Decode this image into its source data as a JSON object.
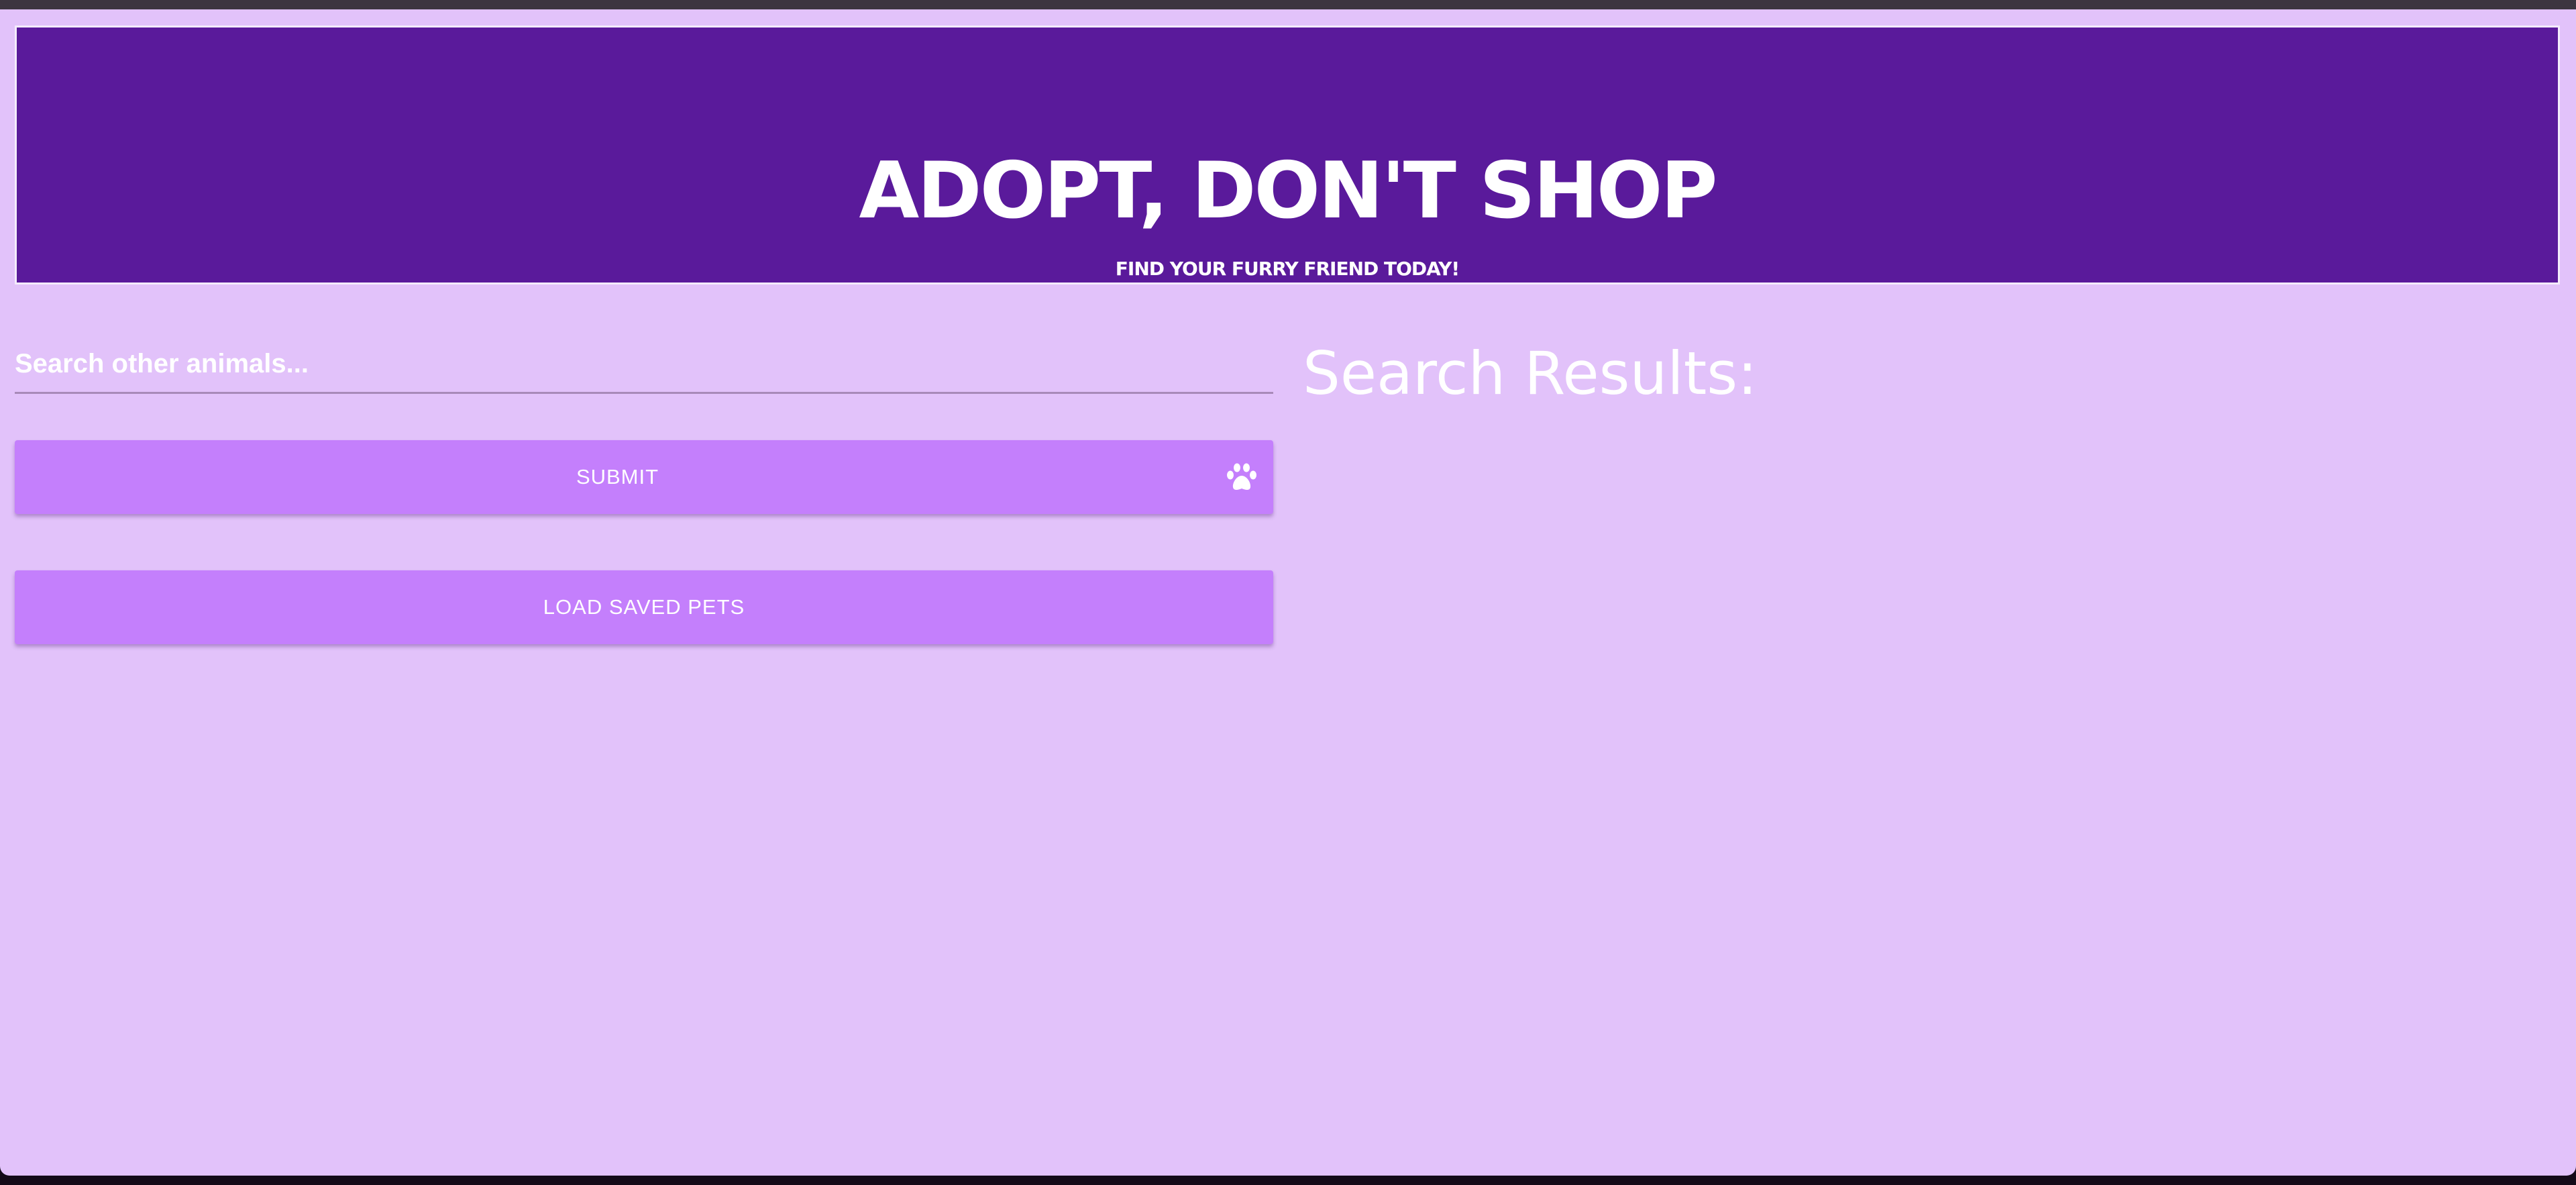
{
  "header": {
    "title": "ADOPT, DON'T SHOP",
    "subtitle": "FIND YOUR FURRY FRIEND TODAY!"
  },
  "search": {
    "placeholder": "Search other animals..."
  },
  "buttons": {
    "submit_label": "SUBMIT",
    "load_saved_label": "LOAD SAVED PETS",
    "submit_icon": "paw-icon"
  },
  "results": {
    "title": "Search Results:"
  },
  "colors": {
    "header_bg": "#5a1a9b",
    "page_bg": "#e2c2fa",
    "button_bg": "#c47ffc",
    "text": "#ffffff"
  }
}
